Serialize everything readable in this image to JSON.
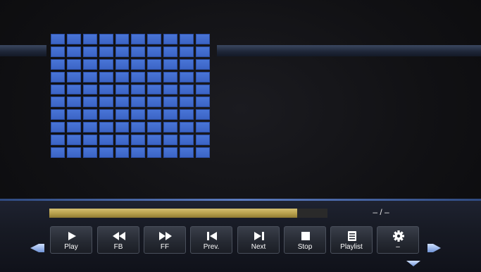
{
  "thumbnail_grid": {
    "rows": 10,
    "cols": 10,
    "tile_color": "#3f69cc"
  },
  "progress": {
    "fraction": 0.89,
    "fill_color": "#c2ab57"
  },
  "time_display": "– / –",
  "controls": [
    {
      "id": "play",
      "label": "Play",
      "icon": "play-icon"
    },
    {
      "id": "fb",
      "label": "FB",
      "icon": "fast-backward-icon"
    },
    {
      "id": "ff",
      "label": "FF",
      "icon": "fast-forward-icon"
    },
    {
      "id": "prev",
      "label": "Prev.",
      "icon": "skip-previous-icon"
    },
    {
      "id": "next",
      "label": "Next",
      "icon": "skip-next-icon"
    },
    {
      "id": "stop",
      "label": "Stop",
      "icon": "stop-icon"
    },
    {
      "id": "playlist",
      "label": "Playlist",
      "icon": "playlist-icon"
    },
    {
      "id": "settings",
      "label": "–",
      "icon": "gear-icon"
    }
  ],
  "nav": {
    "left": "left-arrow-icon",
    "right": "right-arrow-icon",
    "down": "down-arrow-icon"
  },
  "accent_color": "#5b7bc0"
}
